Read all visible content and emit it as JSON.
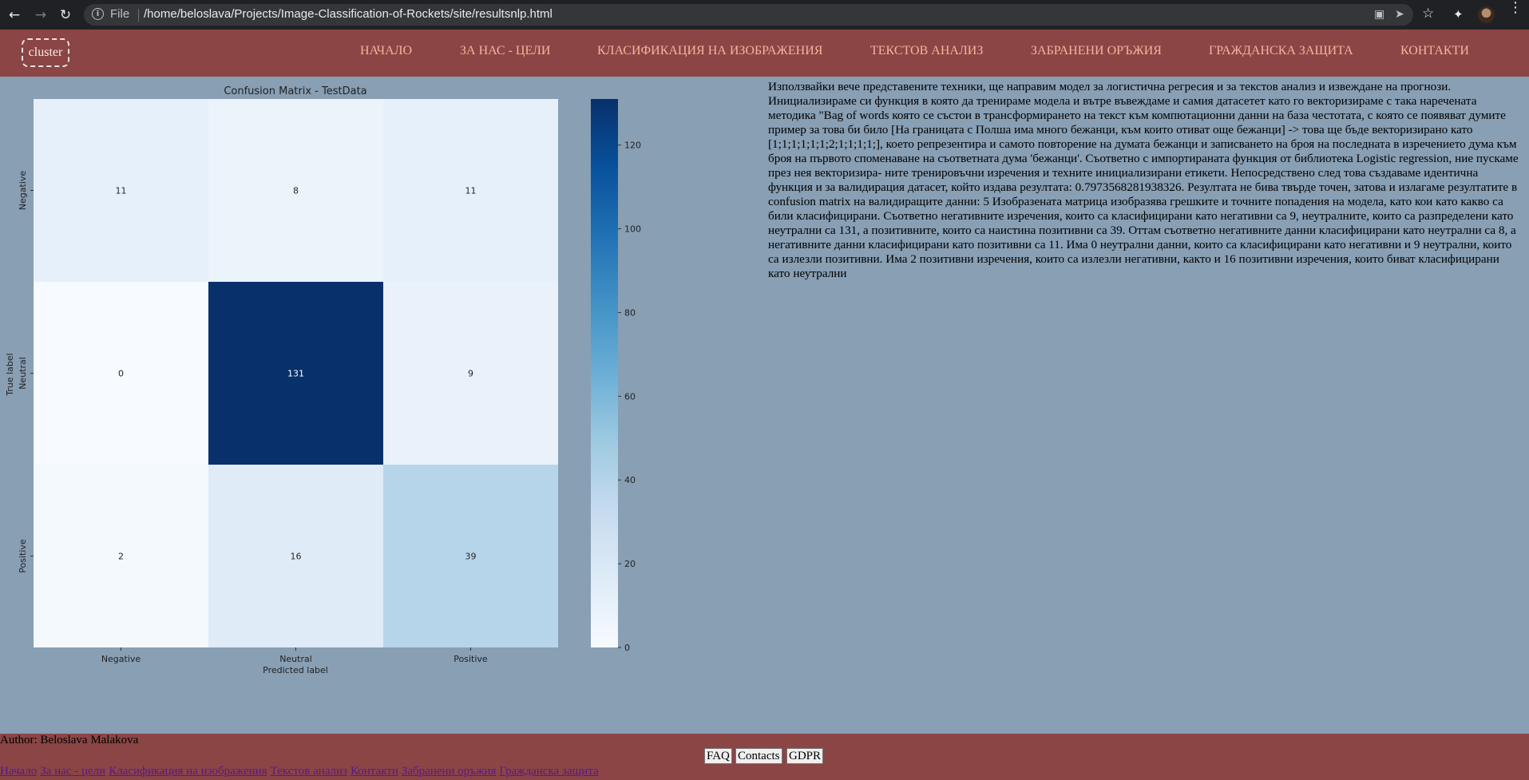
{
  "browser": {
    "file_label": "File",
    "url": "/home/beloslava/Projects/Image-Classification-of-Rockets/site/resultsnlp.html"
  },
  "site": {
    "logo": "cluster",
    "nav": [
      "НАЧАЛО",
      "ЗА НАС - ЦЕЛИ",
      "КЛАСИФИКАЦИЯ НА ИЗОБРАЖЕНИЯ",
      "ТЕКСТОВ АНАЛИЗ",
      "ЗАБРАНЕНИ ОРЪЖИЯ",
      "ГРАЖДАНСКА ЗАЩИТА",
      "КОНТАКТИ"
    ]
  },
  "colors": {
    "header_bg": "#8b4545",
    "page_bg": "#889fb4",
    "nav_text": "#f2b59b"
  },
  "chart_data": {
    "type": "heatmap",
    "title": "Confusion Matrix - TestData",
    "xlabel": "Predicted label",
    "ylabel": "True label",
    "x_categories": [
      "Negative",
      "Neutral",
      "Positive"
    ],
    "y_categories": [
      "Negative",
      "Neutral",
      "Positive"
    ],
    "matrix": [
      [
        11,
        8,
        11
      ],
      [
        0,
        131,
        9
      ],
      [
        2,
        16,
        39
      ]
    ],
    "colormap": "Blues",
    "colorbar_ticks": [
      0,
      20,
      40,
      60,
      80,
      100,
      120
    ],
    "vmin": 0,
    "vmax": 131
  },
  "article": "Използвайки вече представените техники, ще направим модел за логистична регресия и за текстов анализ и извеждане на прогнози. Инициализираме си функция в която да тренираме модела и вътре въвеждаме и самия датасетет като го векторизираме с така наречената методика \"Bag of words която се състои в трансформирането на текст към компютационни данни на база честотата, с която се появяват думите пример за това би било [На границата с Полша има много бежанци, към които отиват още бежанци] -> това ще бъде векторизирано като [1;1;1;1;1;1;2;1;1;1;1;], което репрезентира и самото повторение на думата бежанци и записването на броя на последната в изречението дума към броя на първото споменаване на съответната дума 'бежанци'. Съответно с импортираната функция от библиотека Logistic regression, ние пускаме през нея векторизира- ните тренировъчни изречения и техните инициализирани етикети. Непосредствено след това създаваме идентична функция и за валидирация датасет, който издава резултата: 0.7973568281938326. Резултата не бива твърде точен, затова и излагаме резултатите в confusion matrix на валидиращите данни: 5 Изобразената матрица изобразява грешките и точните попадения на модела, като кои като какво са били класифицирани. Съответно негативните изречения, които са класифицирани като негативни са 9, неутралните, които са разпределени като неутрални са 131, а позитивните, които са наистина позитивни са 39. Оттам съответно негативните данни класифицирани като неутрални са 8, а негативните данни класифицирани като позитивни са 11. Има 0 неутрални данни, които са класифицирани като негативни и 9 неутрални, които са излезли позитивни. Има 2 позитивни изречения, които са излезли негативни, както и 16 позитивни изречения, които биват класифицирани като неутрални",
  "footer": {
    "author": "Author: Beloslava Malakova",
    "buttons": [
      "FAQ",
      "Contacts",
      "GDPR"
    ],
    "links": [
      "Начало",
      "За нас - цели",
      "Класификация на изображения",
      "Текстов анализ",
      "Контакти",
      "Забранени оръжия",
      "Гражданска защита"
    ]
  }
}
